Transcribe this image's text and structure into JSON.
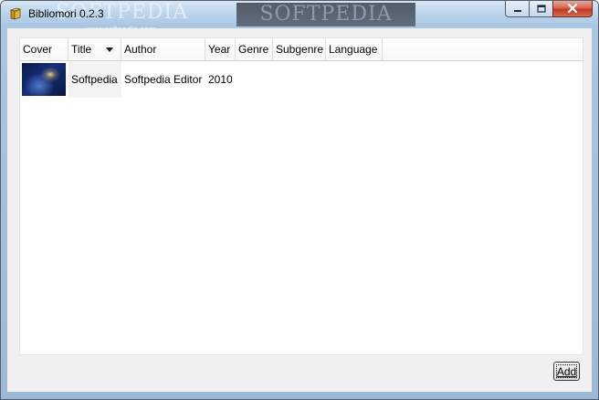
{
  "window": {
    "title": "Bibliomori 0.2.3",
    "watermark": "SOFTPEDIA",
    "watermark_url": "www.softpedia.com"
  },
  "table": {
    "columns": [
      {
        "key": "cover",
        "label": "Cover"
      },
      {
        "key": "title",
        "label": "Title",
        "sorted": true
      },
      {
        "key": "author",
        "label": "Author"
      },
      {
        "key": "year",
        "label": "Year"
      },
      {
        "key": "genre",
        "label": "Genre"
      },
      {
        "key": "subgenre",
        "label": "Subgenre"
      },
      {
        "key": "language",
        "label": "Language"
      }
    ],
    "rows": [
      {
        "title": "Softpedia",
        "author": "Softpedia Editor",
        "year": "2010",
        "genre": "",
        "subgenre": "",
        "language": ""
      }
    ]
  },
  "actions": {
    "add_label": "Add"
  },
  "icons": {
    "app": "book-icon",
    "minimize": "minimize-icon",
    "maximize": "maximize-icon",
    "close": "close-icon",
    "sort": "sort-descending-icon"
  }
}
